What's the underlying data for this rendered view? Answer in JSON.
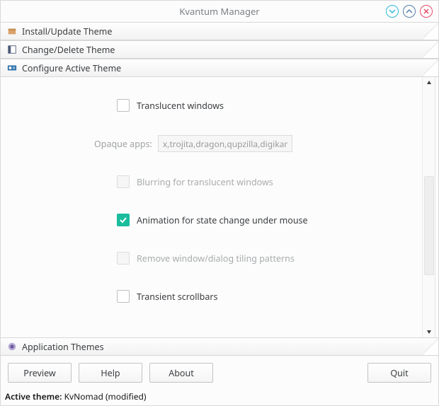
{
  "window": {
    "title": "Kvantum Manager"
  },
  "sections": {
    "install": {
      "label": "Install/Update Theme"
    },
    "change": {
      "label": "Change/Delete Theme"
    },
    "configure": {
      "label": "Configure Active Theme"
    },
    "apps": {
      "label": "Application Themes"
    }
  },
  "options": {
    "translucent": {
      "label": "Translucent windows",
      "checked": false,
      "enabled": true
    },
    "opaque_apps": {
      "label": "Opaque apps:",
      "value": "x,trojita,dragon,qupzilla,digikam",
      "enabled": false
    },
    "blurring": {
      "label": "Blurring for translucent windows",
      "checked": false,
      "enabled": false
    },
    "animation": {
      "label": "Animation for state change under mouse",
      "checked": true,
      "enabled": true
    },
    "remove_tiling": {
      "label": "Remove window/dialog tiling patterns",
      "checked": false,
      "enabled": false
    },
    "transient_scroll": {
      "label": "Transient scrollbars",
      "checked": false,
      "enabled": true
    }
  },
  "buttons": {
    "preview": "Preview",
    "help": "Help",
    "about": "About",
    "quit": "Quit"
  },
  "status": {
    "prefix": "Active theme:",
    "value": "KvNomad (modified)"
  }
}
